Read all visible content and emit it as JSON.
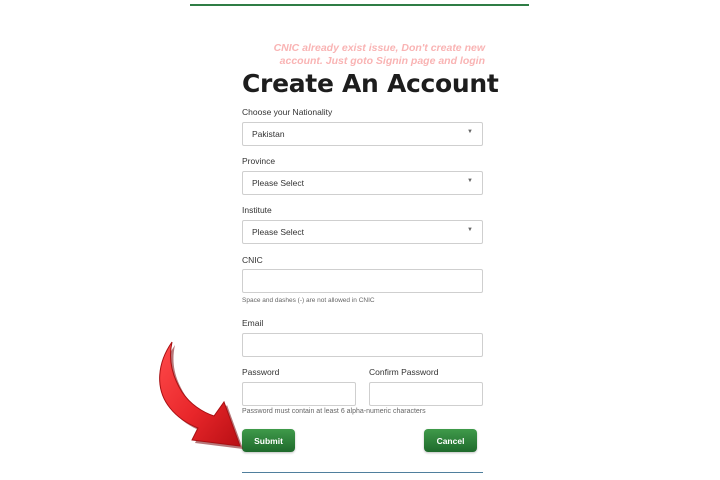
{
  "notice": {
    "line1": "CNIC already exist issue, Don't create new",
    "line2": "account. Just goto Signin page and login"
  },
  "title": "Create An Account",
  "form": {
    "nationality": {
      "label": "Choose your Nationality",
      "value": "Pakistan"
    },
    "province": {
      "label": "Province",
      "value": "Please Select"
    },
    "institute": {
      "label": "Institute",
      "value": "Please Select"
    },
    "cnic": {
      "label": "CNIC",
      "value": "",
      "hint": "Space and dashes (-) are not allowed in CNIC"
    },
    "email": {
      "label": "Email",
      "value": ""
    },
    "password": {
      "label": "Password",
      "value": ""
    },
    "confirm_password": {
      "label": "Confirm Password",
      "value": ""
    },
    "password_hint": "Password must contain at least 6 alpha-numeric characters"
  },
  "buttons": {
    "submit": "Submit",
    "cancel": "Cancel"
  },
  "colors": {
    "accent_green": "#2f7d45",
    "arrow_red": "#e8262a",
    "notice_pink": "#f9b4b4"
  },
  "icons": {
    "select_caret": "caret-down-icon",
    "pointer": "red-arrow-icon"
  }
}
